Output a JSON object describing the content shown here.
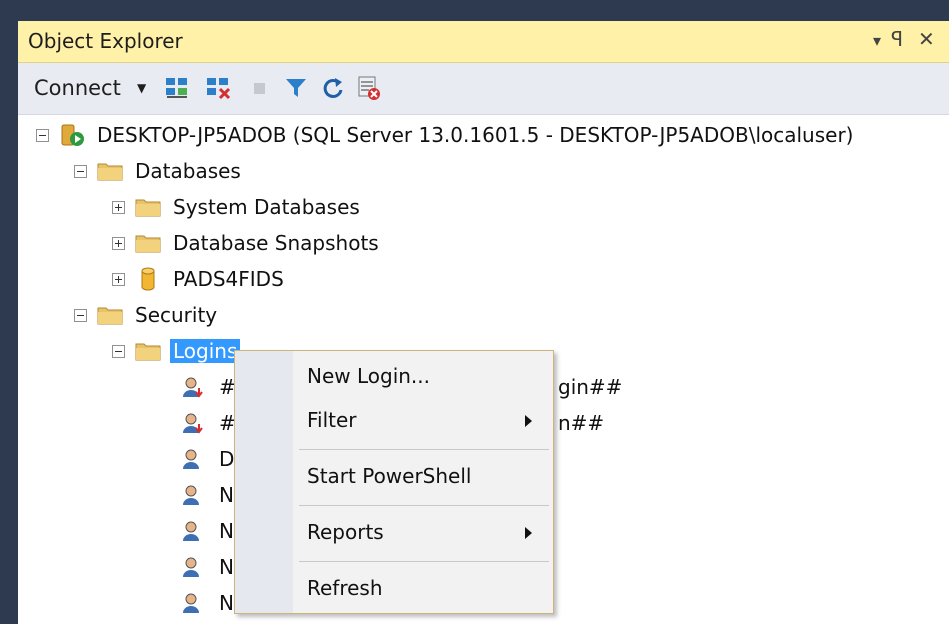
{
  "panel": {
    "title": "Object Explorer",
    "controls": {
      "dropdown": "▾",
      "pin": "ꟼ",
      "close": "✕"
    }
  },
  "toolbar": {
    "connect_label": "Connect",
    "icons": [
      "connect-object-explorer-icon",
      "disconnect-icon",
      "stop-icon",
      "filter-icon",
      "refresh-icon",
      "activity-monitor-icon"
    ]
  },
  "tree": {
    "server": "DESKTOP-JP5ADOB (SQL Server 13.0.1601.5 - DESKTOP-JP5ADOB\\localuser)",
    "databases": "Databases",
    "system_databases": "System Databases",
    "database_snapshots": "Database Snapshots",
    "user_db": "PADS4FIDS",
    "security": "Security",
    "logins": "Logins",
    "login_items": [
      {
        "visible_prefix": "#",
        "visible_suffix": "gin##"
      },
      {
        "visible_prefix": "#",
        "visible_suffix": "n##"
      },
      {
        "visible_prefix": "D",
        "visible_suffix": ""
      },
      {
        "visible_prefix": "N",
        "visible_suffix": ""
      },
      {
        "visible_prefix": "N",
        "visible_suffix": ""
      },
      {
        "visible_prefix": "N",
        "visible_suffix": ""
      },
      {
        "visible_prefix": "N",
        "visible_suffix": ""
      }
    ]
  },
  "context_menu": {
    "new_login": "New Login...",
    "filter": "Filter",
    "start_powershell": "Start PowerShell",
    "reports": "Reports",
    "refresh": "Refresh"
  },
  "colors": {
    "titlebar": "#fff2a8",
    "selection": "#3399ff",
    "menu_border": "#cbb57a"
  }
}
